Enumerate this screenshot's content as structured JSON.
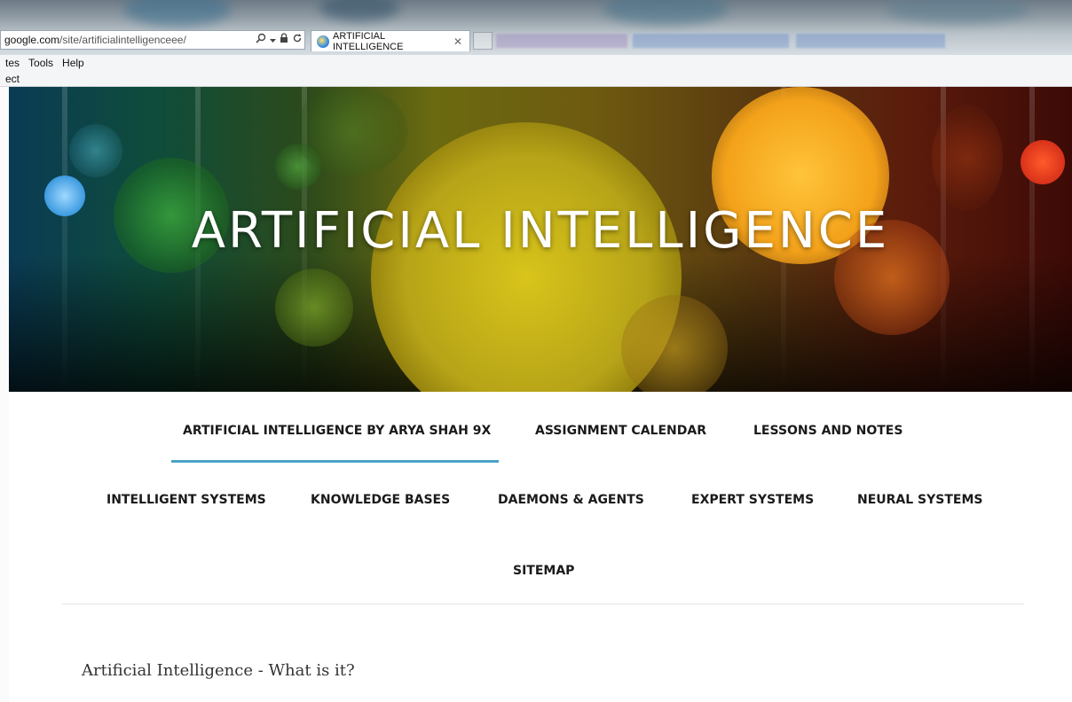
{
  "browser": {
    "address_domain": "google.com",
    "address_path": "/site/artificialintelligenceee/",
    "active_tab_title": "ARTIFICIAL INTELLIGENCE",
    "menu_items": [
      "tes",
      "Tools",
      "Help"
    ],
    "favorites_text": "ect"
  },
  "hero": {
    "title": "ARTIFICIAL INTELLIGENCE"
  },
  "nav": {
    "row1": [
      "ARTIFICIAL INTELLIGENCE BY ARYA SHAH 9X",
      "ASSIGNMENT CALENDAR",
      "LESSONS AND NOTES"
    ],
    "row2": [
      "INTELLIGENT SYSTEMS",
      "KNOWLEDGE BASES",
      "DAEMONS & AGENTS",
      "EXPERT SYSTEMS",
      "NEURAL SYSTEMS"
    ],
    "row3": [
      "SITEMAP"
    ],
    "active": "ARTIFICIAL INTELLIGENCE BY ARYA SHAH 9X"
  },
  "content": {
    "heading": "Artificial Intelligence - What is it?"
  },
  "colors": {
    "nav_active_underline": "#4ba3c7",
    "nav_text": "#1a1a1a",
    "hero_title": "#ffffff"
  },
  "icons": [
    "search-icon",
    "dropdown-icon",
    "lock-icon",
    "refresh-icon",
    "ie-logo-icon",
    "close-icon"
  ]
}
